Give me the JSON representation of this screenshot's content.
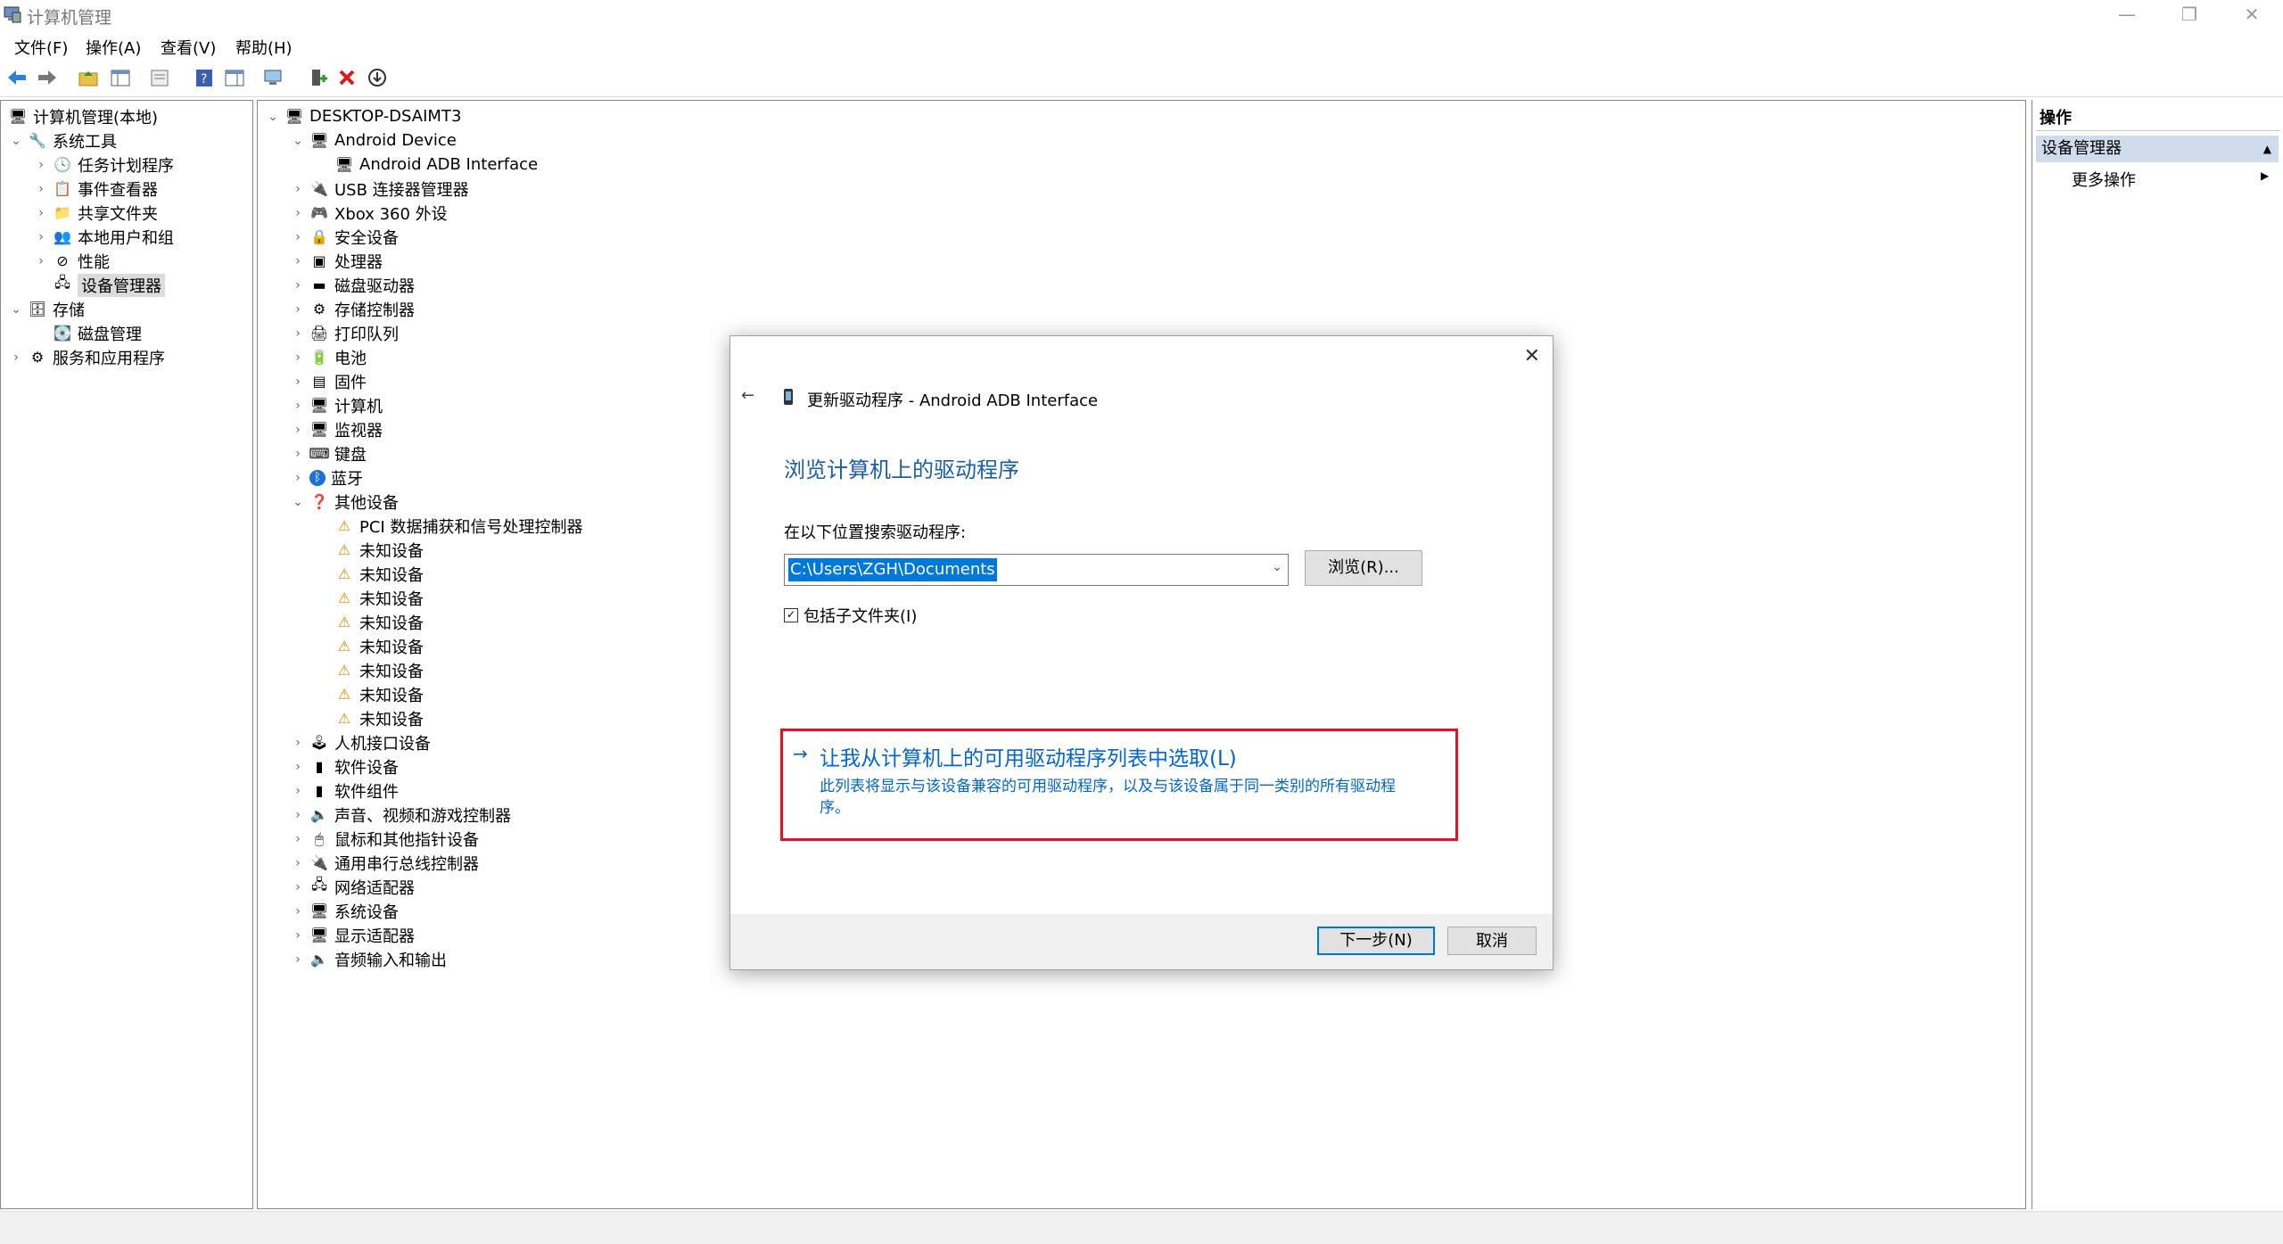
{
  "window": {
    "title": "计算机管理",
    "minimize": "—",
    "restore": "❐",
    "close": "✕"
  },
  "menu": [
    "文件(F)",
    "操作(A)",
    "查看(V)",
    "帮助(H)"
  ],
  "left_tree": {
    "root": "计算机管理(本地)",
    "items": [
      {
        "label": "系统工具",
        "level": 1,
        "chev": "⌄",
        "icon": "tools-icon"
      },
      {
        "label": "任务计划程序",
        "level": 2,
        "chev": "›",
        "icon": "clock-icon"
      },
      {
        "label": "事件查看器",
        "level": 2,
        "chev": "›",
        "icon": "event-icon"
      },
      {
        "label": "共享文件夹",
        "level": 2,
        "chev": "›",
        "icon": "folder-icon"
      },
      {
        "label": "本地用户和组",
        "level": 2,
        "chev": "›",
        "icon": "users-icon"
      },
      {
        "label": "性能",
        "level": 2,
        "chev": "›",
        "icon": "performance-icon"
      },
      {
        "label": "设备管理器",
        "level": 2,
        "chev": "",
        "icon": "device-manager-icon",
        "selected": true
      },
      {
        "label": "存储",
        "level": 1,
        "chev": "⌄",
        "icon": "storage-icon"
      },
      {
        "label": "磁盘管理",
        "level": 2,
        "chev": "",
        "icon": "disk-icon"
      },
      {
        "label": "服务和应用程序",
        "level": 1,
        "chev": "›",
        "icon": "services-icon"
      }
    ]
  },
  "device_tree": {
    "root": "DESKTOP-DSAIMT3",
    "items": [
      {
        "label": "Android Device",
        "level": 1,
        "chev": "⌄",
        "icon": "android-device-icon"
      },
      {
        "label": "Android ADB Interface",
        "level": 2,
        "chev": "",
        "icon": "monitor-icon"
      },
      {
        "label": "USB 连接器管理器",
        "level": 1,
        "chev": "›",
        "icon": "usb-icon"
      },
      {
        "label": "Xbox 360 外设",
        "level": 1,
        "chev": "›",
        "icon": "gamepad-icon"
      },
      {
        "label": "安全设备",
        "level": 1,
        "chev": "›",
        "icon": "security-icon"
      },
      {
        "label": "处理器",
        "level": 1,
        "chev": "›",
        "icon": "cpu-icon"
      },
      {
        "label": "磁盘驱动器",
        "level": 1,
        "chev": "›",
        "icon": "disk-drive-icon"
      },
      {
        "label": "存储控制器",
        "level": 1,
        "chev": "›",
        "icon": "storage-controller-icon"
      },
      {
        "label": "打印队列",
        "level": 1,
        "chev": "›",
        "icon": "printer-icon"
      },
      {
        "label": "电池",
        "level": 1,
        "chev": "›",
        "icon": "battery-icon"
      },
      {
        "label": "固件",
        "level": 1,
        "chev": "›",
        "icon": "firmware-icon"
      },
      {
        "label": "计算机",
        "level": 1,
        "chev": "›",
        "icon": "computer-icon"
      },
      {
        "label": "监视器",
        "level": 1,
        "chev": "›",
        "icon": "monitor-icon"
      },
      {
        "label": "键盘",
        "level": 1,
        "chev": "›",
        "icon": "keyboard-icon"
      },
      {
        "label": "蓝牙",
        "level": 1,
        "chev": "›",
        "icon": "bluetooth-icon"
      },
      {
        "label": "其他设备",
        "level": 1,
        "chev": "⌄",
        "icon": "other-devices-icon"
      },
      {
        "label": "PCI 数据捕获和信号处理控制器",
        "level": 2,
        "chev": "",
        "icon": "warning-device-icon"
      },
      {
        "label": "未知设备",
        "level": 2,
        "chev": "",
        "icon": "warning-device-icon"
      },
      {
        "label": "未知设备",
        "level": 2,
        "chev": "",
        "icon": "warning-device-icon"
      },
      {
        "label": "未知设备",
        "level": 2,
        "chev": "",
        "icon": "warning-device-icon"
      },
      {
        "label": "未知设备",
        "level": 2,
        "chev": "",
        "icon": "warning-device-icon"
      },
      {
        "label": "未知设备",
        "level": 2,
        "chev": "",
        "icon": "warning-device-icon"
      },
      {
        "label": "未知设备",
        "level": 2,
        "chev": "",
        "icon": "warning-device-icon"
      },
      {
        "label": "未知设备",
        "level": 2,
        "chev": "",
        "icon": "warning-device-icon"
      },
      {
        "label": "未知设备",
        "level": 2,
        "chev": "",
        "icon": "warning-device-icon"
      },
      {
        "label": "人机接口设备",
        "level": 1,
        "chev": "›",
        "icon": "hid-icon"
      },
      {
        "label": "软件设备",
        "level": 1,
        "chev": "›",
        "icon": "software-device-icon"
      },
      {
        "label": "软件组件",
        "level": 1,
        "chev": "›",
        "icon": "software-component-icon"
      },
      {
        "label": "声音、视频和游戏控制器",
        "level": 1,
        "chev": "›",
        "icon": "sound-icon"
      },
      {
        "label": "鼠标和其他指针设备",
        "level": 1,
        "chev": "›",
        "icon": "mouse-icon"
      },
      {
        "label": "通用串行总线控制器",
        "level": 1,
        "chev": "›",
        "icon": "usb-controller-icon"
      },
      {
        "label": "网络适配器",
        "level": 1,
        "chev": "›",
        "icon": "network-icon"
      },
      {
        "label": "系统设备",
        "level": 1,
        "chev": "›",
        "icon": "system-device-icon"
      },
      {
        "label": "显示适配器",
        "level": 1,
        "chev": "›",
        "icon": "display-adapter-icon"
      },
      {
        "label": "音频输入和输出",
        "level": 1,
        "chev": "›",
        "icon": "audio-icon"
      }
    ]
  },
  "actions": {
    "header": "操作",
    "section": "设备管理器",
    "more": "更多操作"
  },
  "dialog": {
    "breadcrumb": "更新驱动程序 - Android ADB Interface",
    "heading": "浏览计算机上的驱动程序",
    "search_label": "在以下位置搜索驱动程序:",
    "path_value": "C:\\Users\\ZGH\\Documents",
    "browse_button": "浏览(R)...",
    "include_subfolders": "包括子文件夹(I)",
    "pick_title": "让我从计算机上的可用驱动程序列表中选取(L)",
    "pick_desc_1": "此列表将显示与该设备兼容的可用驱动程序，以及与该设备属于同一类别的所有驱动程",
    "pick_desc_2": "序。",
    "next_button": "下一步(N)",
    "cancel_button": "取消"
  },
  "colors": {
    "accent": "#0078d7",
    "heading_blue": "#1a5ea8",
    "link_blue": "#0066cc",
    "highlight_red": "#e81123",
    "section_bg": "#cfdcec"
  }
}
